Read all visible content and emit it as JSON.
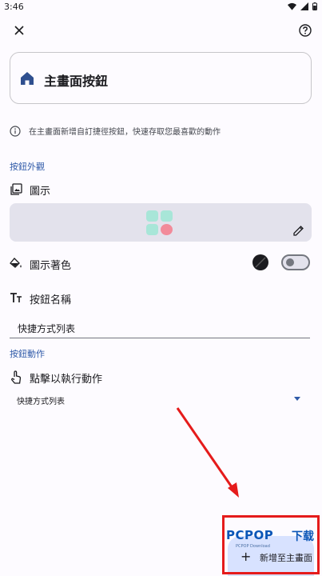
{
  "status_bar": {
    "time": "3:46"
  },
  "header": {
    "close_icon": "close-icon",
    "help_icon": "help-icon"
  },
  "preview": {
    "title": "主畫面按鈕",
    "icon": "home-icon",
    "icon_color": "#2f4f8f"
  },
  "info": {
    "text": "在主畫面新增自訂捷徑按鈕，快速存取您最喜歡的動作"
  },
  "appearance": {
    "section_title": "按鈕外觀",
    "icon_label": "圖示",
    "icon_color_label": "圖示著色",
    "button_name_label": "按鈕名稱",
    "button_name_value": "快捷方式列表"
  },
  "action": {
    "section_title": "按鈕動作",
    "tap_label": "點擊以執行動作",
    "dropdown_value": "快捷方式列表"
  },
  "fab": {
    "label": "新增至主畫面"
  },
  "watermark": {
    "brand": "PCPOP",
    "brand_suffix": "下载",
    "subtitle": "PCPOP Download"
  },
  "colors": {
    "accent": "#2f5aa8",
    "highlight": "#e51b1b",
    "fab_bg": "#d8e2ff",
    "mint": "#a8e6d8",
    "pink": "#f28b9a"
  }
}
